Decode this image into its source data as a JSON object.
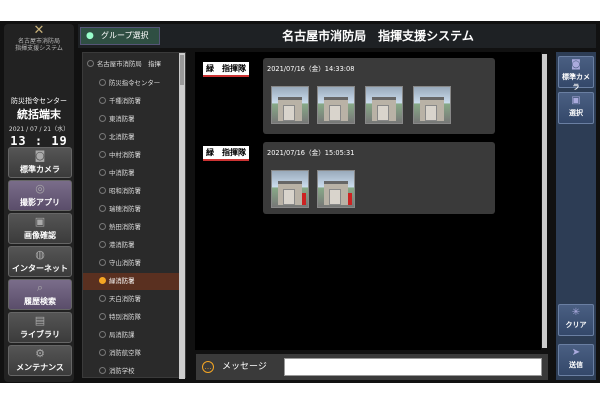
{
  "sidebar": {
    "org_line1": "名古屋市消防局",
    "org_line2": "指揮支援システム",
    "center_label": "防災指令センター",
    "terminal": "統括端末",
    "date": "2021 / 07 / 21（水）",
    "time": "13 : 19 : 23",
    "buttons": [
      {
        "label": "標準カメラ",
        "icon": "camera-icon"
      },
      {
        "label": "撮影アプリ",
        "icon": "app-icon"
      },
      {
        "label": "画像確認",
        "icon": "image-icon"
      },
      {
        "label": "インターネット",
        "icon": "globe-icon"
      },
      {
        "label": "履歴検索",
        "icon": "history-icon"
      },
      {
        "label": "ライブラリ",
        "icon": "book-icon"
      },
      {
        "label": "メンテナンス",
        "icon": "gear-icon"
      }
    ]
  },
  "header": {
    "group_button": "グループ選択",
    "title": "名古屋市消防局　指揮支援システム"
  },
  "tree": {
    "items": [
      "名古屋市消防局　指揮",
      "防災指令センター",
      "千種消防署",
      "東消防署",
      "北消防署",
      "中村消防署",
      "中消防署",
      "昭和消防署",
      "瑞穂消防署",
      "熱田消防署",
      "港消防署",
      "守山消防署",
      "緑消防署",
      "天白消防署",
      "特別消防隊",
      "局消防課",
      "消防航空隊",
      "消防学校"
    ],
    "selected": "緑消防署"
  },
  "messages": [
    {
      "sender": "緑　指揮隊",
      "timestamp": "2021/07/16（金）14:33:08",
      "photos": 4
    },
    {
      "sender": "緑　指揮隊",
      "timestamp": "2021/07/16（金）15:05:31",
      "photos": 2
    }
  ],
  "input": {
    "label": "メッセージ",
    "value": ""
  },
  "right_rail": {
    "camera": "標準カメラ",
    "select": "選択",
    "clear": "クリア",
    "send": "送信"
  }
}
